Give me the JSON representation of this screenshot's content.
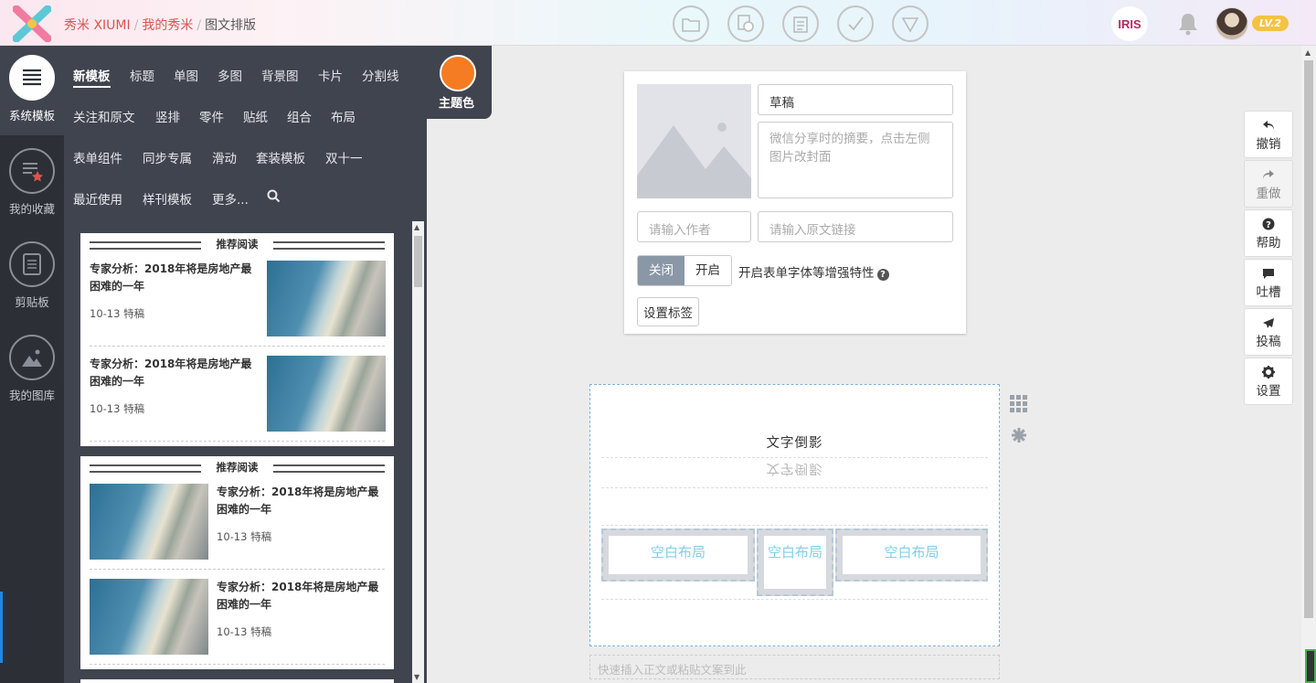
{
  "breadcrumb": {
    "site": "秀米 XIUMI",
    "section": "我的秀米",
    "page": "图文排版",
    "separator": "/"
  },
  "header_icons": [
    "folder-icon",
    "copy-icon",
    "clipboard-icon",
    "check-icon",
    "download-triangle-icon"
  ],
  "user": {
    "brand_badge": "IRIS",
    "level": "LV.2"
  },
  "sidebar": [
    {
      "label": "系统模板",
      "icon": "list-icon",
      "selected": true
    },
    {
      "label": "我的收藏",
      "icon": "favorites-icon",
      "selected": false
    },
    {
      "label": "剪贴板",
      "icon": "clipboard-icon",
      "selected": false
    },
    {
      "label": "我的图库",
      "icon": "gallery-icon",
      "selected": false
    }
  ],
  "categories": [
    [
      "新模板",
      "标题",
      "单图",
      "多图",
      "背景图",
      "卡片",
      "分割线"
    ],
    [
      "关注和原文",
      "竖排",
      "零件",
      "贴纸",
      "组合",
      "布局"
    ],
    [
      "表单组件",
      "同步专属",
      "滑动",
      "套装模板",
      "双十一"
    ],
    [
      "最近使用",
      "样刊模板",
      "更多..."
    ]
  ],
  "theme": {
    "label": "主题色",
    "color": "#f57c22"
  },
  "templates": [
    {
      "heading": "推荐阅读",
      "items": [
        {
          "title": "专家分析：2018年将是房地产最困难的一年",
          "date": "10-13 特稿"
        },
        {
          "title": "专家分析：2018年将是房地产最困难的一年",
          "date": "10-13 特稿"
        }
      ]
    },
    {
      "heading": "推荐阅读",
      "items": [
        {
          "title": "专家分析：2018年将是房地产最困难的一年",
          "date": "10-13 特稿"
        },
        {
          "title": "专家分析：2018年将是房地产最困难的一年",
          "date": "10-13 特稿"
        }
      ]
    }
  ],
  "cover": {
    "title_value": "草稿",
    "summary_placeholder": "微信分享时的摘要，点击左侧图片改封面",
    "author_placeholder": "请输入作者",
    "link_placeholder": "请输入原文链接",
    "toggle_off": "关闭",
    "toggle_on": "开启",
    "toggle_desc": "开启表单字体等增强特性",
    "tag_button": "设置标签"
  },
  "editor": {
    "reflection_text": "文字倒影",
    "layout_cells": [
      "空白布局",
      "空白布局",
      "空白布局"
    ],
    "quick_insert": "快速插入正文或粘贴文案到此"
  },
  "right_actions": [
    {
      "label": "撤销",
      "icon": "undo-icon",
      "disabled": false
    },
    {
      "label": "重做",
      "icon": "redo-icon",
      "disabled": true
    },
    {
      "label": "帮助",
      "icon": "help-icon",
      "disabled": false
    },
    {
      "label": "吐槽",
      "icon": "comment-icon",
      "disabled": false
    },
    {
      "label": "投稿",
      "icon": "send-icon",
      "disabled": false
    },
    {
      "label": "设置",
      "icon": "gear-icon",
      "disabled": false
    }
  ]
}
